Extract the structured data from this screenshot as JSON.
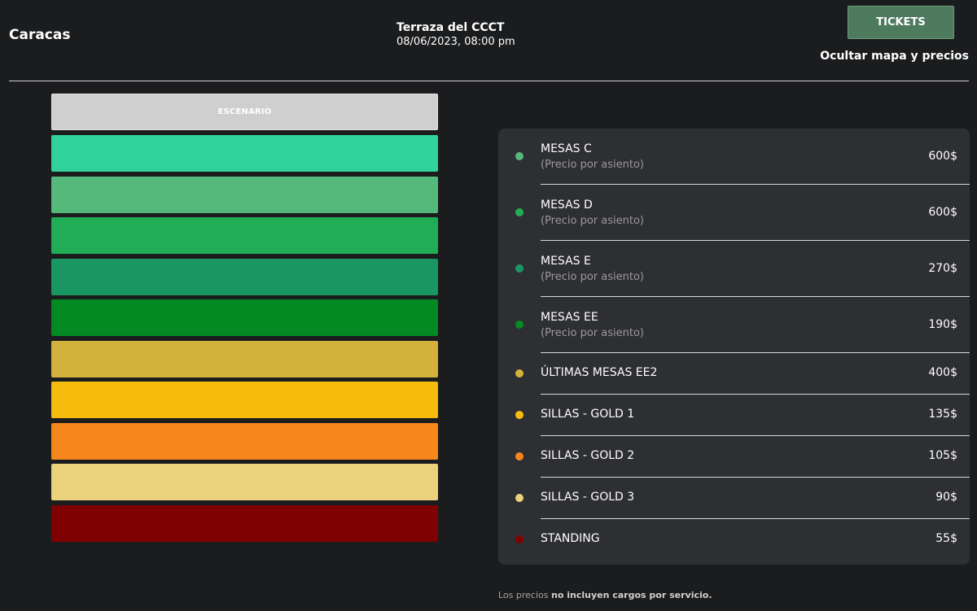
{
  "header": {
    "city": "Caracas",
    "venue": "Terraza del CCCT",
    "datetime": "08/06/2023, 08:00 pm",
    "tickets_label": "TICKETS",
    "toggle_map_label": "Ocultar mapa y precios"
  },
  "map": {
    "stage_label": "ESCENARIO",
    "zones": [
      {
        "color": "#30d39b"
      },
      {
        "color": "#56b97c"
      },
      {
        "color": "#21ad55"
      },
      {
        "color": "#1a9663"
      },
      {
        "color": "#038a22"
      },
      {
        "color": "#d3b13c"
      },
      {
        "color": "#f6bc0d"
      },
      {
        "color": "#f6871c"
      },
      {
        "color": "#ead27c"
      },
      {
        "color": "#800101"
      }
    ]
  },
  "prices": [
    {
      "name": "MESAS C",
      "note": "(Precio por asiento)",
      "price": "600$",
      "color": "#56b97c"
    },
    {
      "name": "MESAS D",
      "note": "(Precio por asiento)",
      "price": "600$",
      "color": "#21ad55"
    },
    {
      "name": "MESAS E",
      "note": "(Precio por asiento)",
      "price": "270$",
      "color": "#1a9663"
    },
    {
      "name": "MESAS EE",
      "note": "(Precio por asiento)",
      "price": "190$",
      "color": "#038a22"
    },
    {
      "name": "ÚLTIMAS MESAS EE2",
      "price": "400$",
      "color": "#d3b13c"
    },
    {
      "name": "SILLAS - GOLD 1",
      "price": "135$",
      "color": "#f6bc0d"
    },
    {
      "name": "SILLAS - GOLD 2",
      "price": "105$",
      "color": "#f6871c"
    },
    {
      "name": "SILLAS - GOLD 3",
      "price": "90$",
      "color": "#ead27c"
    },
    {
      "name": "STANDING",
      "price": "55$",
      "color": "#800101"
    }
  ],
  "footnote": {
    "prefix": "Los precios ",
    "bold": "no incluyen cargos por servicio."
  }
}
